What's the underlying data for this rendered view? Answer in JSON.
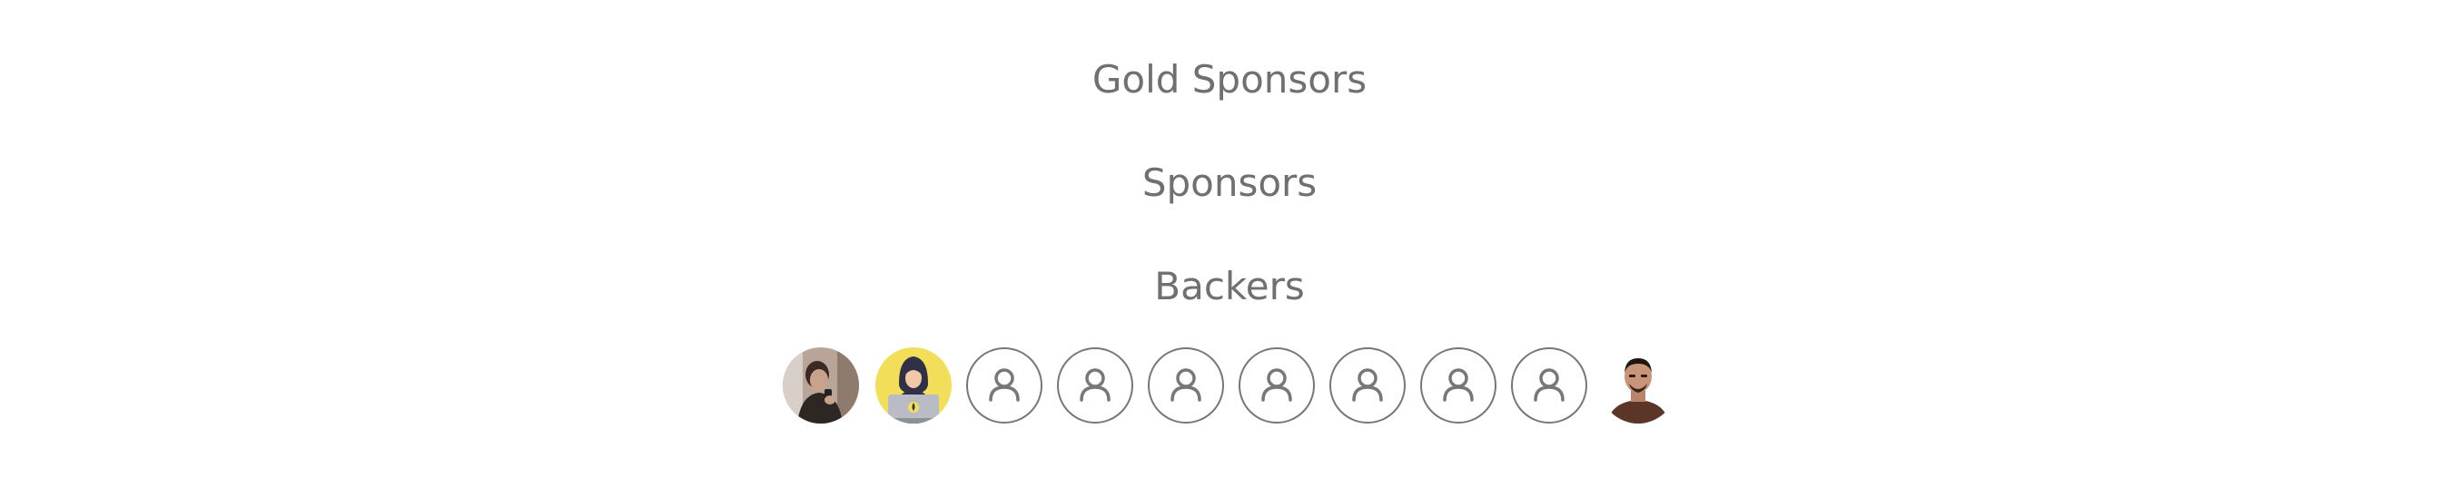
{
  "sections": {
    "gold_sponsors_title": "Gold Sponsors",
    "sponsors_title": "Sponsors",
    "backers_title": "Backers"
  },
  "backers": [
    {
      "type": "photo",
      "icon": "person-photo-avatar"
    },
    {
      "type": "illustration",
      "icon": "hooded-hacker-laptop-avatar"
    },
    {
      "type": "placeholder",
      "icon": "user-icon"
    },
    {
      "type": "placeholder",
      "icon": "user-icon"
    },
    {
      "type": "placeholder",
      "icon": "user-icon"
    },
    {
      "type": "placeholder",
      "icon": "user-icon"
    },
    {
      "type": "placeholder",
      "icon": "user-icon"
    },
    {
      "type": "placeholder",
      "icon": "user-icon"
    },
    {
      "type": "placeholder",
      "icon": "user-icon"
    },
    {
      "type": "photo",
      "icon": "person-photo-avatar"
    }
  ],
  "colors": {
    "heading_text": "#707070",
    "placeholder_stroke": "#777777",
    "hacker_background": "#f3de5a"
  }
}
